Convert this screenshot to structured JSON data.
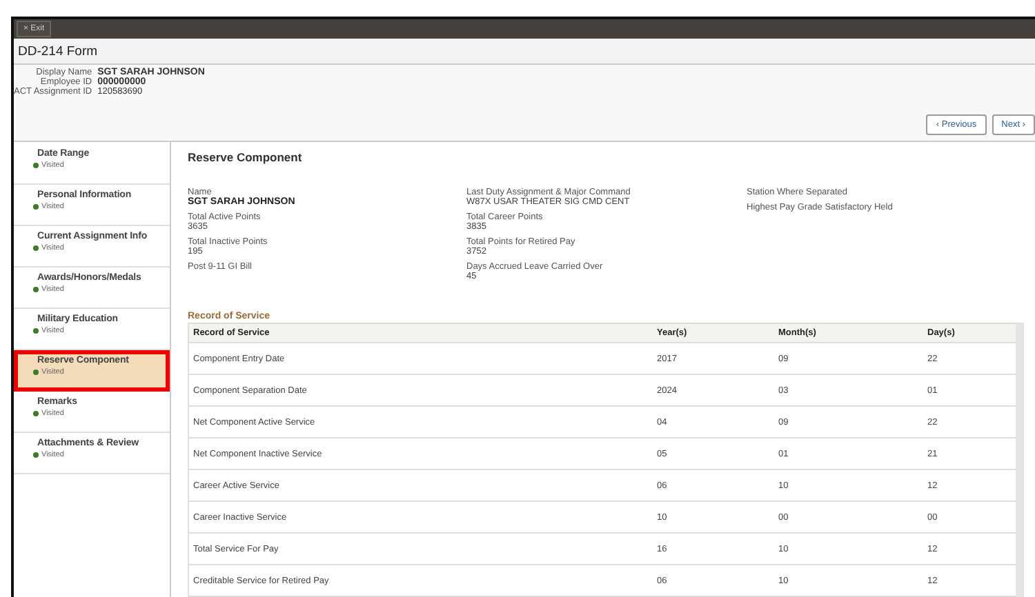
{
  "toolbar": {
    "exit_button": "× Exit"
  },
  "window": {
    "title": "DD-214 Form"
  },
  "header": {
    "fields": [
      {
        "label": "Display Name",
        "value": "SGT SARAH JOHNSON"
      },
      {
        "label": "Employee ID",
        "value": "000000000"
      },
      {
        "label": "ACT Assignment ID",
        "value": "120583690"
      }
    ],
    "buttons": [
      {
        "label": "‹ Previous"
      },
      {
        "label": "Next ›"
      }
    ]
  },
  "sidebar": {
    "items": [
      {
        "label": "Date Range",
        "status": "Visited",
        "color": "#3d7a2a",
        "selected": false
      },
      {
        "label": "Personal Information",
        "status": "Visited",
        "color": "#3d7a2a",
        "selected": false
      },
      {
        "label": "Current Assignment Info",
        "status": "Visited",
        "color": "#3d7a2a",
        "selected": false
      },
      {
        "label": "Awards/Honors/Medals",
        "status": "Visited",
        "color": "#3d7a2a",
        "selected": false
      },
      {
        "label": "Military Education",
        "status": "Visited",
        "color": "#3d7a2a",
        "selected": false
      },
      {
        "label": "Reserve Component",
        "status": "Visited",
        "color": "#3d7a2a",
        "selected": true
      },
      {
        "label": "Remarks",
        "status": "Visited",
        "color": "#3d7a2a",
        "selected": false
      },
      {
        "label": "Attachments & Review",
        "status": "Visited",
        "color": "#3d7a2a",
        "selected": false
      }
    ]
  },
  "section": {
    "title": "Reserve Component",
    "columns": [
      [
        {
          "label": "Name",
          "value": "SGT SARAH JOHNSON",
          "bold_value": true
        },
        {
          "label": "Total Active Points",
          "value": "3635",
          "bold_value": false
        },
        {
          "label": "Total Inactive Points",
          "value": "195",
          "bold_value": false
        },
        {
          "label": "Post 9-11 GI Bill"
        }
      ],
      [
        {
          "label": "Last Duty Assignment & Major Command",
          "value": "W87X USAR THEATER SIG CMD CENT",
          "bold_value": false
        },
        {
          "label": "Total Career Points",
          "value": "3835",
          "bold_value": false
        },
        {
          "label": "Total Points for Retired Pay",
          "value": "3752",
          "bold_value": false
        },
        {
          "label": "Days Accrued Leave Carried Over",
          "value": "45",
          "bold_value": false
        }
      ],
      [
        {
          "label": "Station Where Separated"
        },
        {
          "label": "Highest Pay Grade Satisfactory Held"
        }
      ]
    ]
  },
  "table": {
    "caption": "Record of Service",
    "columns": [
      "Record of Service",
      "Year(s)",
      "Month(s)",
      "Day(s)"
    ],
    "rows": [
      [
        "Component Entry Date",
        "2017",
        "09",
        "22"
      ],
      [
        "Component Separation Date",
        "2024",
        "03",
        "01"
      ],
      [
        "Net Component Active Service",
        "04",
        "09",
        "22"
      ],
      [
        "Net Component Inactive Service",
        "05",
        "01",
        "21"
      ],
      [
        "Career Active Service",
        "06",
        "10",
        "12"
      ],
      [
        "Career Inactive Service",
        "10",
        "00",
        "00"
      ],
      [
        "Total Service For Pay",
        "16",
        "10",
        "12"
      ],
      [
        "Creditable Service for Retired Pay",
        "06",
        "10",
        "12"
      ]
    ]
  }
}
